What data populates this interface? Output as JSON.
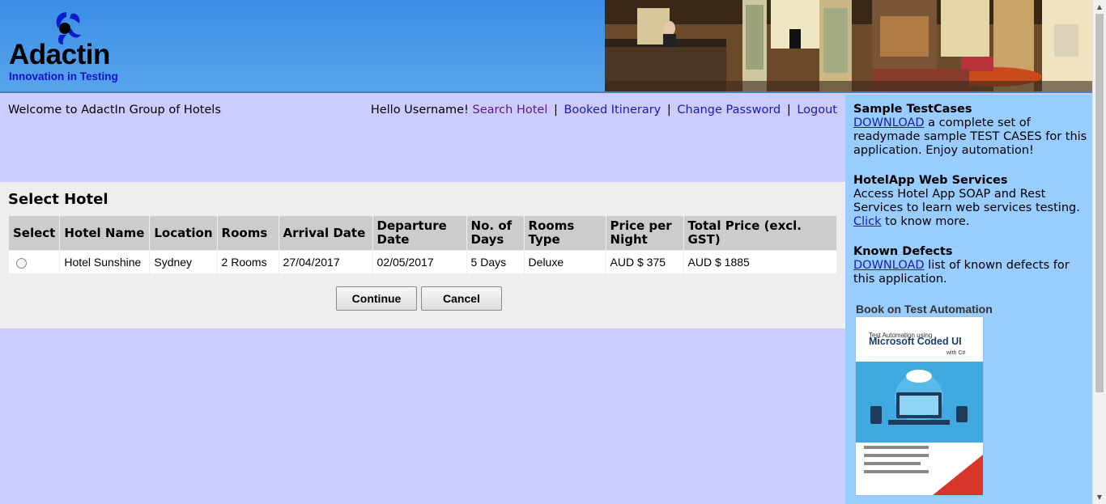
{
  "header": {
    "logo_text": "Adactin",
    "logo_tagline": "Innovation in Testing",
    "logo_icon": "adactin-swirl-logo",
    "photo": "hotel-lobby-photo"
  },
  "welcome": {
    "text": "Welcome to AdactIn Group of Hotels",
    "greeting": "Hello Username!",
    "nav": {
      "search_hotel": "Search Hotel",
      "booked_itinerary": "Booked Itinerary",
      "change_password": "Change Password",
      "logout": "Logout",
      "separator": "|"
    }
  },
  "select_hotel": {
    "title": "Select Hotel",
    "columns": [
      "Select",
      "Hotel Name",
      "Location",
      "Rooms",
      "Arrival Date",
      "Departure Date",
      "No. of Days",
      "Rooms Type",
      "Price per Night",
      "Total Price (excl. GST)"
    ],
    "rows": [
      {
        "hotel_name": "Hotel Sunshine",
        "location": "Sydney",
        "rooms": "2 Rooms",
        "arrival_date": "27/04/2017",
        "departure_date": "02/05/2017",
        "days": "5 Days",
        "room_type": "Deluxe",
        "price_per_night": "AUD $ 375",
        "total_price": "AUD $ 1885",
        "selected": false
      }
    ],
    "continue_label": "Continue",
    "cancel_label": "Cancel"
  },
  "sidebar": {
    "testcases": {
      "title": "Sample TestCases",
      "link": "DOWNLOAD",
      "text": " a complete set of readymade sample TEST CASES for this application. Enjoy automation!"
    },
    "webservices": {
      "title": "HotelApp Web Services",
      "text": "Access Hotel App SOAP and Rest Services to learn web services testing. ",
      "link": "Click",
      "text_after": " to know more."
    },
    "defects": {
      "title": "Known Defects",
      "link": "DOWNLOAD",
      "text": " list of known defects for this application."
    },
    "book": {
      "heading": "Book on Test Automation",
      "cover_top": "Test Automation using",
      "cover_title": "Microsoft Coded UI",
      "cover_sub": "with C#"
    }
  },
  "colors": {
    "page_bg": "#ccccff",
    "panel_bg": "#eeeeee",
    "header_bg": "#4a9be8",
    "sidebar_bg": "#99ccff",
    "link": "#1a1ab8",
    "visited_link": "#551a8b"
  }
}
